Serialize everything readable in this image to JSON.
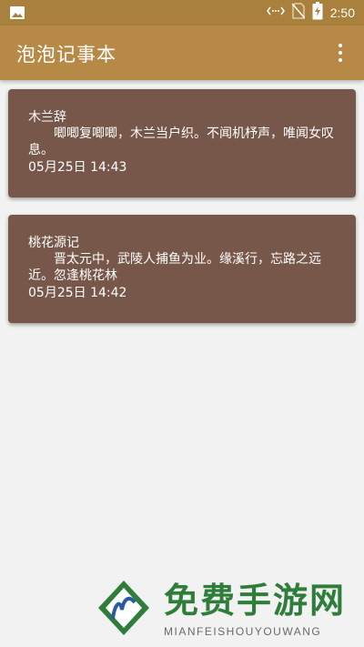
{
  "status_bar": {
    "time": "2:50",
    "icons": [
      "image-icon",
      "data-sync-icon",
      "no-sim-icon",
      "battery-charging-icon"
    ]
  },
  "app_bar": {
    "title": "泡泡记事本",
    "menu_icon": "more-vert-icon"
  },
  "notes": [
    {
      "title": "木兰辞",
      "body": "唧唧复唧唧，木兰当户织。不闻机杼声，唯闻女叹息。",
      "date": "05月25日 14:43"
    },
    {
      "title": "桃花源记",
      "body": "晋太元中，武陵人捕鱼为业。缘溪行，忘路之远近。忽逢桃花林",
      "date": "05月25日 14:42"
    }
  ],
  "watermark": {
    "text": "免费手游网",
    "subtext": "MIANFEISHOUYOUWANG"
  },
  "colors": {
    "status_bar": "#a9803c",
    "app_bar": "#b68946",
    "card": "#775749",
    "background": "#f2f2f2"
  }
}
